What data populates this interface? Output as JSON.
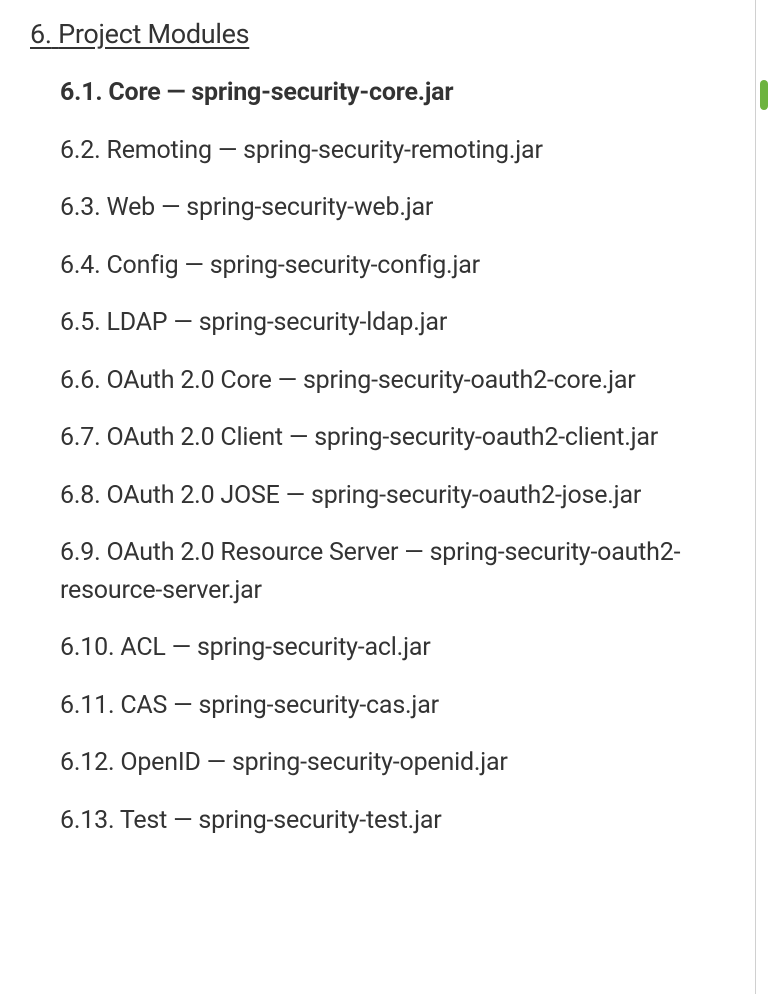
{
  "section": {
    "number": "6.",
    "title": "Project Modules"
  },
  "items": [
    {
      "number": "6.1.",
      "label": "Core — spring-security-core.jar",
      "active": true
    },
    {
      "number": "6.2.",
      "label": "Remoting — spring-security-remoting.jar",
      "active": false
    },
    {
      "number": "6.3.",
      "label": "Web — spring-security-web.jar",
      "active": false
    },
    {
      "number": "6.4.",
      "label": "Config — spring-security-config.jar",
      "active": false
    },
    {
      "number": "6.5.",
      "label": "LDAP — spring-security-ldap.jar",
      "active": false
    },
    {
      "number": "6.6.",
      "label": "OAuth 2.0 Core — spring-security-oauth2-core.jar",
      "active": false
    },
    {
      "number": "6.7.",
      "label": "OAuth 2.0 Client — spring-security-oauth2-client.jar",
      "active": false
    },
    {
      "number": "6.8.",
      "label": "OAuth 2.0 JOSE — spring-security-oauth2-jose.jar",
      "active": false
    },
    {
      "number": "6.9.",
      "label": "OAuth 2.0 Resource Server — spring-security-oauth2-resource-server.jar",
      "active": false
    },
    {
      "number": "6.10.",
      "label": "ACL — spring-security-acl.jar",
      "active": false
    },
    {
      "number": "6.11.",
      "label": "CAS — spring-security-cas.jar",
      "active": false
    },
    {
      "number": "6.12.",
      "label": "OpenID — spring-security-openid.jar",
      "active": false
    },
    {
      "number": "6.13.",
      "label": "Test — spring-security-test.jar",
      "active": false
    }
  ]
}
